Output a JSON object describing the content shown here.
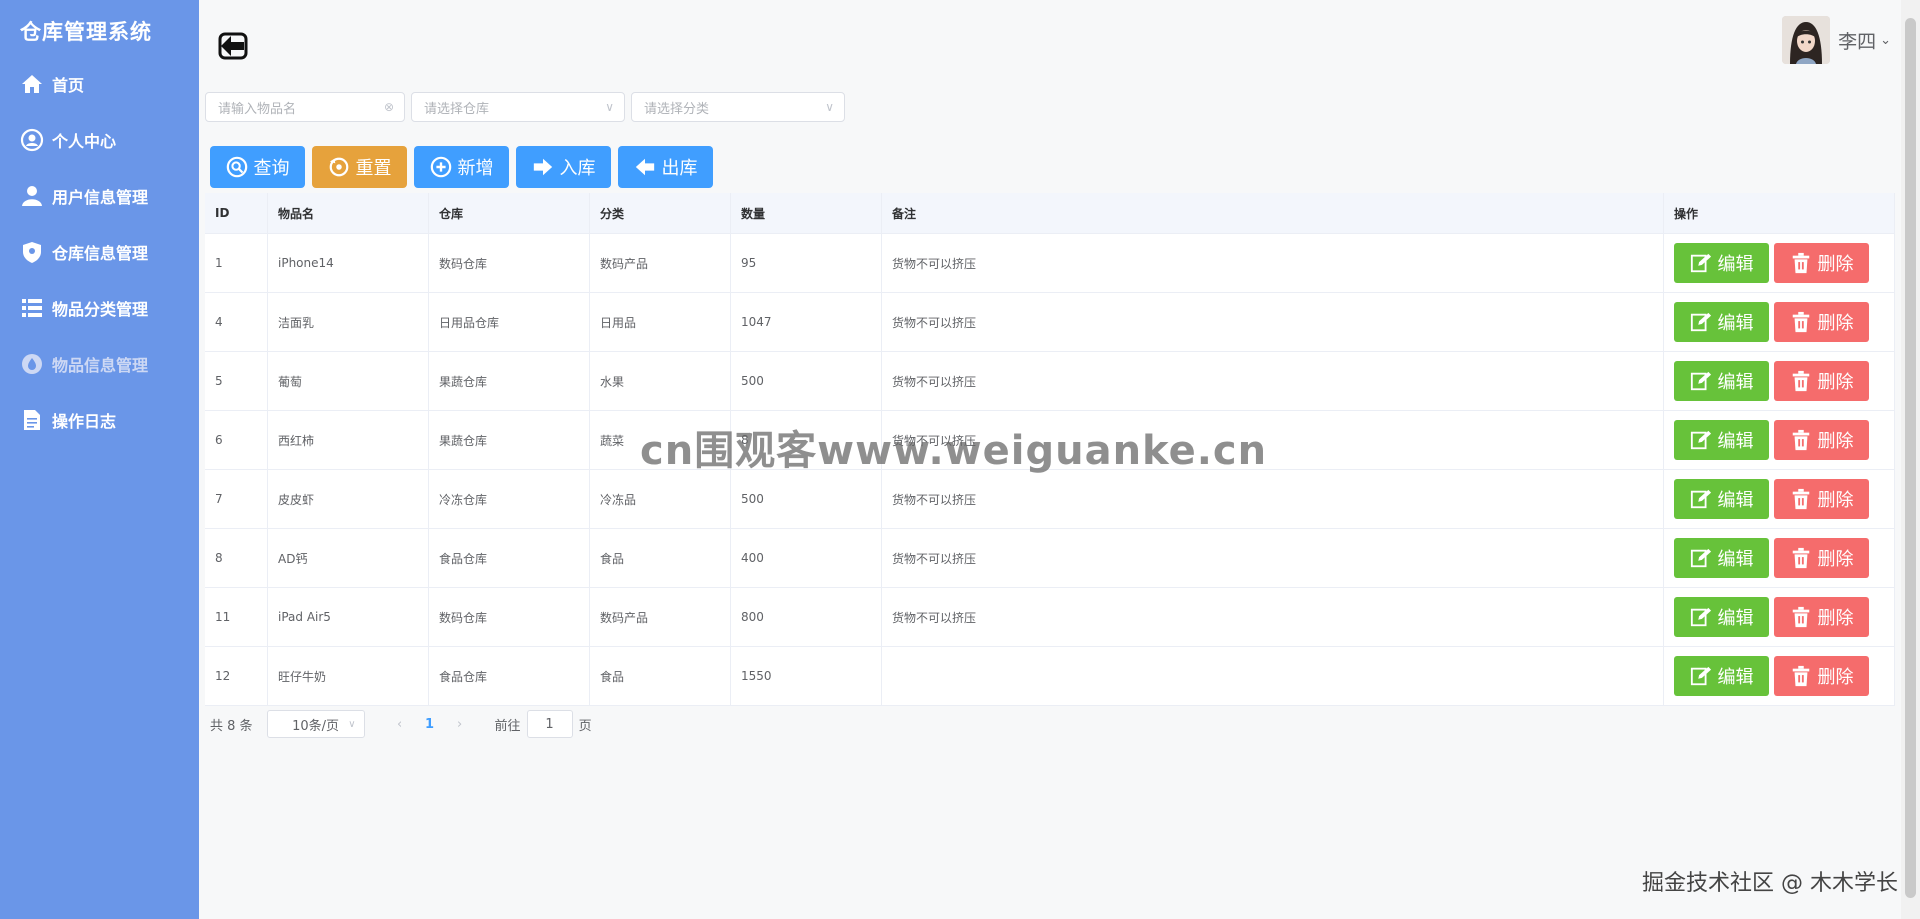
{
  "app": {
    "title": "仓库管理系统"
  },
  "sidebar": {
    "items": [
      {
        "label": "首页",
        "icon": "home-icon"
      },
      {
        "label": "个人中心",
        "icon": "user-circle-icon"
      },
      {
        "label": "用户信息管理",
        "icon": "user-icon"
      },
      {
        "label": "仓库信息管理",
        "icon": "shield-icon"
      },
      {
        "label": "物品分类管理",
        "icon": "list-icon"
      },
      {
        "label": "物品信息管理",
        "icon": "drop-icon",
        "active": true
      },
      {
        "label": "操作日志",
        "icon": "document-icon"
      }
    ]
  },
  "header": {
    "user_name": "李四"
  },
  "filters": {
    "name_placeholder": "请输入物品名",
    "warehouse_placeholder": "请选择仓库",
    "category_placeholder": "请选择分类"
  },
  "toolbar": {
    "query": "查询",
    "reset": "重置",
    "add": "新增",
    "inbound": "入库",
    "outbound": "出库"
  },
  "table": {
    "columns": [
      "ID",
      "物品名",
      "仓库",
      "分类",
      "数量",
      "备注",
      "操作"
    ],
    "rows": [
      {
        "id": "1",
        "name": "iPhone14",
        "warehouse": "数码仓库",
        "category": "数码产品",
        "qty": "95",
        "remark": "货物不可以挤压"
      },
      {
        "id": "4",
        "name": "洁面乳",
        "warehouse": "日用品仓库",
        "category": "日用品",
        "qty": "1047",
        "remark": "货物不可以挤压"
      },
      {
        "id": "5",
        "name": "葡萄",
        "warehouse": "果蔬仓库",
        "category": "水果",
        "qty": "500",
        "remark": "货物不可以挤压"
      },
      {
        "id": "6",
        "name": "西红柿",
        "warehouse": "果蔬仓库",
        "category": "蔬菜",
        "qty": "8",
        "remark": "货物不可以挤压"
      },
      {
        "id": "7",
        "name": "皮皮虾",
        "warehouse": "冷冻仓库",
        "category": "冷冻品",
        "qty": "500",
        "remark": "货物不可以挤压"
      },
      {
        "id": "8",
        "name": "AD钙",
        "warehouse": "食品仓库",
        "category": "食品",
        "qty": "400",
        "remark": "货物不可以挤压"
      },
      {
        "id": "11",
        "name": "iPad Air5",
        "warehouse": "数码仓库",
        "category": "数码产品",
        "qty": "800",
        "remark": "货物不可以挤压"
      },
      {
        "id": "12",
        "name": "旺仔牛奶",
        "warehouse": "食品仓库",
        "category": "食品",
        "qty": "1550",
        "remark": ""
      }
    ],
    "edit_label": "编辑",
    "delete_label": "删除"
  },
  "pagination": {
    "total": "共 8 条",
    "page_size": "10条/页",
    "current_page": "1",
    "goto_prefix": "前往",
    "goto_value": "1",
    "goto_suffix": "页"
  },
  "overlay": {
    "watermark": "cn围观客www.weiguanke.cn",
    "credit": "掘金技术社区 @ 木木学长"
  },
  "colors": {
    "sidebar": "#6a96e8",
    "primary": "#409eff",
    "warning": "#e6a23c",
    "success": "#67c23a",
    "danger": "#f56c6c"
  }
}
